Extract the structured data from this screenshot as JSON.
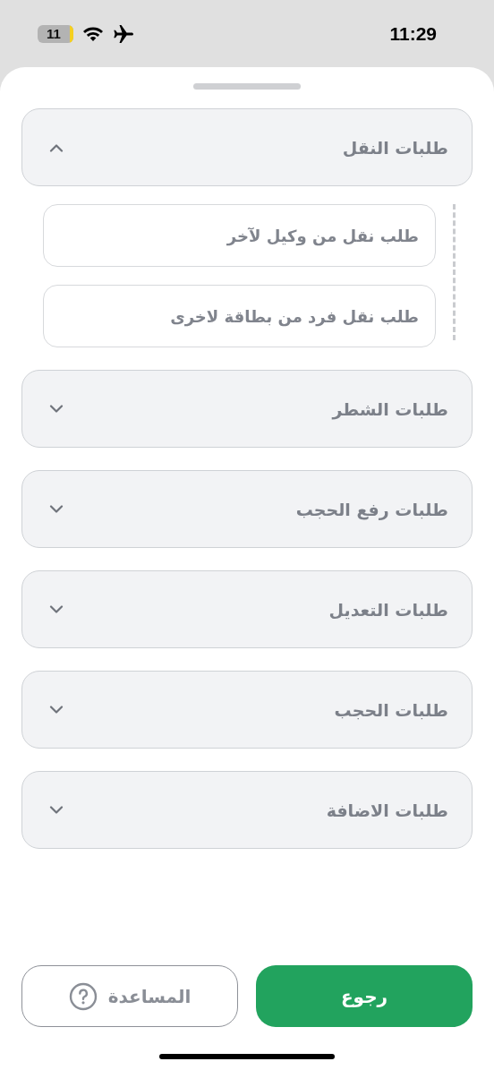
{
  "status_bar": {
    "battery": "11",
    "low_power": true,
    "time": "11:29"
  },
  "sections": [
    {
      "title": "طلبات النقل",
      "expanded": true,
      "items": [
        "طلب نقل من وكيل لآخر",
        "طلب نقل فرد من بطاقة لاخرى"
      ]
    },
    {
      "title": "طلبات الشطر",
      "expanded": false
    },
    {
      "title": "طلبات رفع الحجب",
      "expanded": false
    },
    {
      "title": "طلبات التعديل",
      "expanded": false
    },
    {
      "title": "طلبات الحجب",
      "expanded": false
    },
    {
      "title": "طلبات الاضافة",
      "expanded": false
    }
  ],
  "buttons": [
    {
      "label": "رجوع",
      "kind": "primary"
    },
    {
      "label": "المساعدة",
      "kind": "help"
    }
  ]
}
